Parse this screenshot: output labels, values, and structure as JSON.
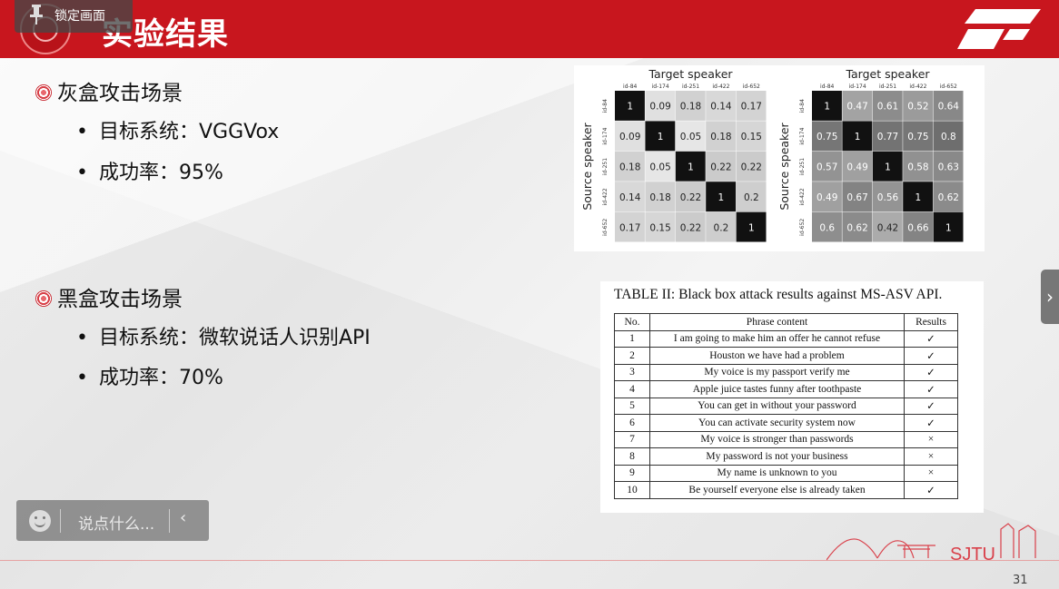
{
  "header": {
    "title": "实验结果"
  },
  "overlay": {
    "lock_label": "锁定画面"
  },
  "sections": [
    {
      "title": "灰盒攻击场景",
      "items": [
        "目标系统：VGGVox",
        "成功率：95%"
      ]
    },
    {
      "title": "黑盒攻击场景",
      "items": [
        "目标系统：微软说话人识别API",
        "成功率：70%"
      ]
    }
  ],
  "heatmaps": {
    "xlabel": "Target speaker",
    "ylabel": "Source speaker",
    "ids": [
      "id-84",
      "id-174",
      "id-251",
      "id-422",
      "id-652"
    ],
    "left": [
      [
        1,
        0.09,
        0.18,
        0.14,
        0.17
      ],
      [
        0.09,
        1,
        0.05,
        0.18,
        0.15
      ],
      [
        0.18,
        0.05,
        1,
        0.22,
        0.22
      ],
      [
        0.14,
        0.18,
        0.22,
        1,
        0.2
      ],
      [
        0.17,
        0.15,
        0.22,
        0.2,
        1
      ]
    ],
    "right": [
      [
        1,
        0.47,
        0.61,
        0.52,
        0.64
      ],
      [
        0.75,
        1,
        0.77,
        0.75,
        0.8
      ],
      [
        0.57,
        0.49,
        1,
        0.58,
        0.63
      ],
      [
        0.49,
        0.67,
        0.56,
        1,
        0.62
      ],
      [
        0.6,
        0.62,
        0.42,
        0.66,
        1
      ]
    ]
  },
  "table": {
    "caption": "TABLE II: Black box attack results against MS-ASV API.",
    "headers": [
      "No.",
      "Phrase content",
      "Results"
    ],
    "rows": [
      [
        "1",
        "I am going to make him an offer he cannot refuse",
        "✓"
      ],
      [
        "2",
        "Houston we have had a problem",
        "✓"
      ],
      [
        "3",
        "My voice is my passport verify me",
        "✓"
      ],
      [
        "4",
        "Apple juice tastes funny after toothpaste",
        "✓"
      ],
      [
        "5",
        "You can get in without your password",
        "✓"
      ],
      [
        "6",
        "You can activate security system now",
        "✓"
      ],
      [
        "7",
        "My voice is stronger than passwords",
        "×"
      ],
      [
        "8",
        "My password is not your business",
        "×"
      ],
      [
        "9",
        "My name is unknown to you",
        "×"
      ],
      [
        "10",
        "Be yourself everyone else is already taken",
        "✓"
      ]
    ]
  },
  "comment": {
    "placeholder": "说点什么..."
  },
  "footer": {
    "logo_text": "SJTU",
    "page": "31"
  },
  "colors": {
    "accent": "#c8161e"
  }
}
